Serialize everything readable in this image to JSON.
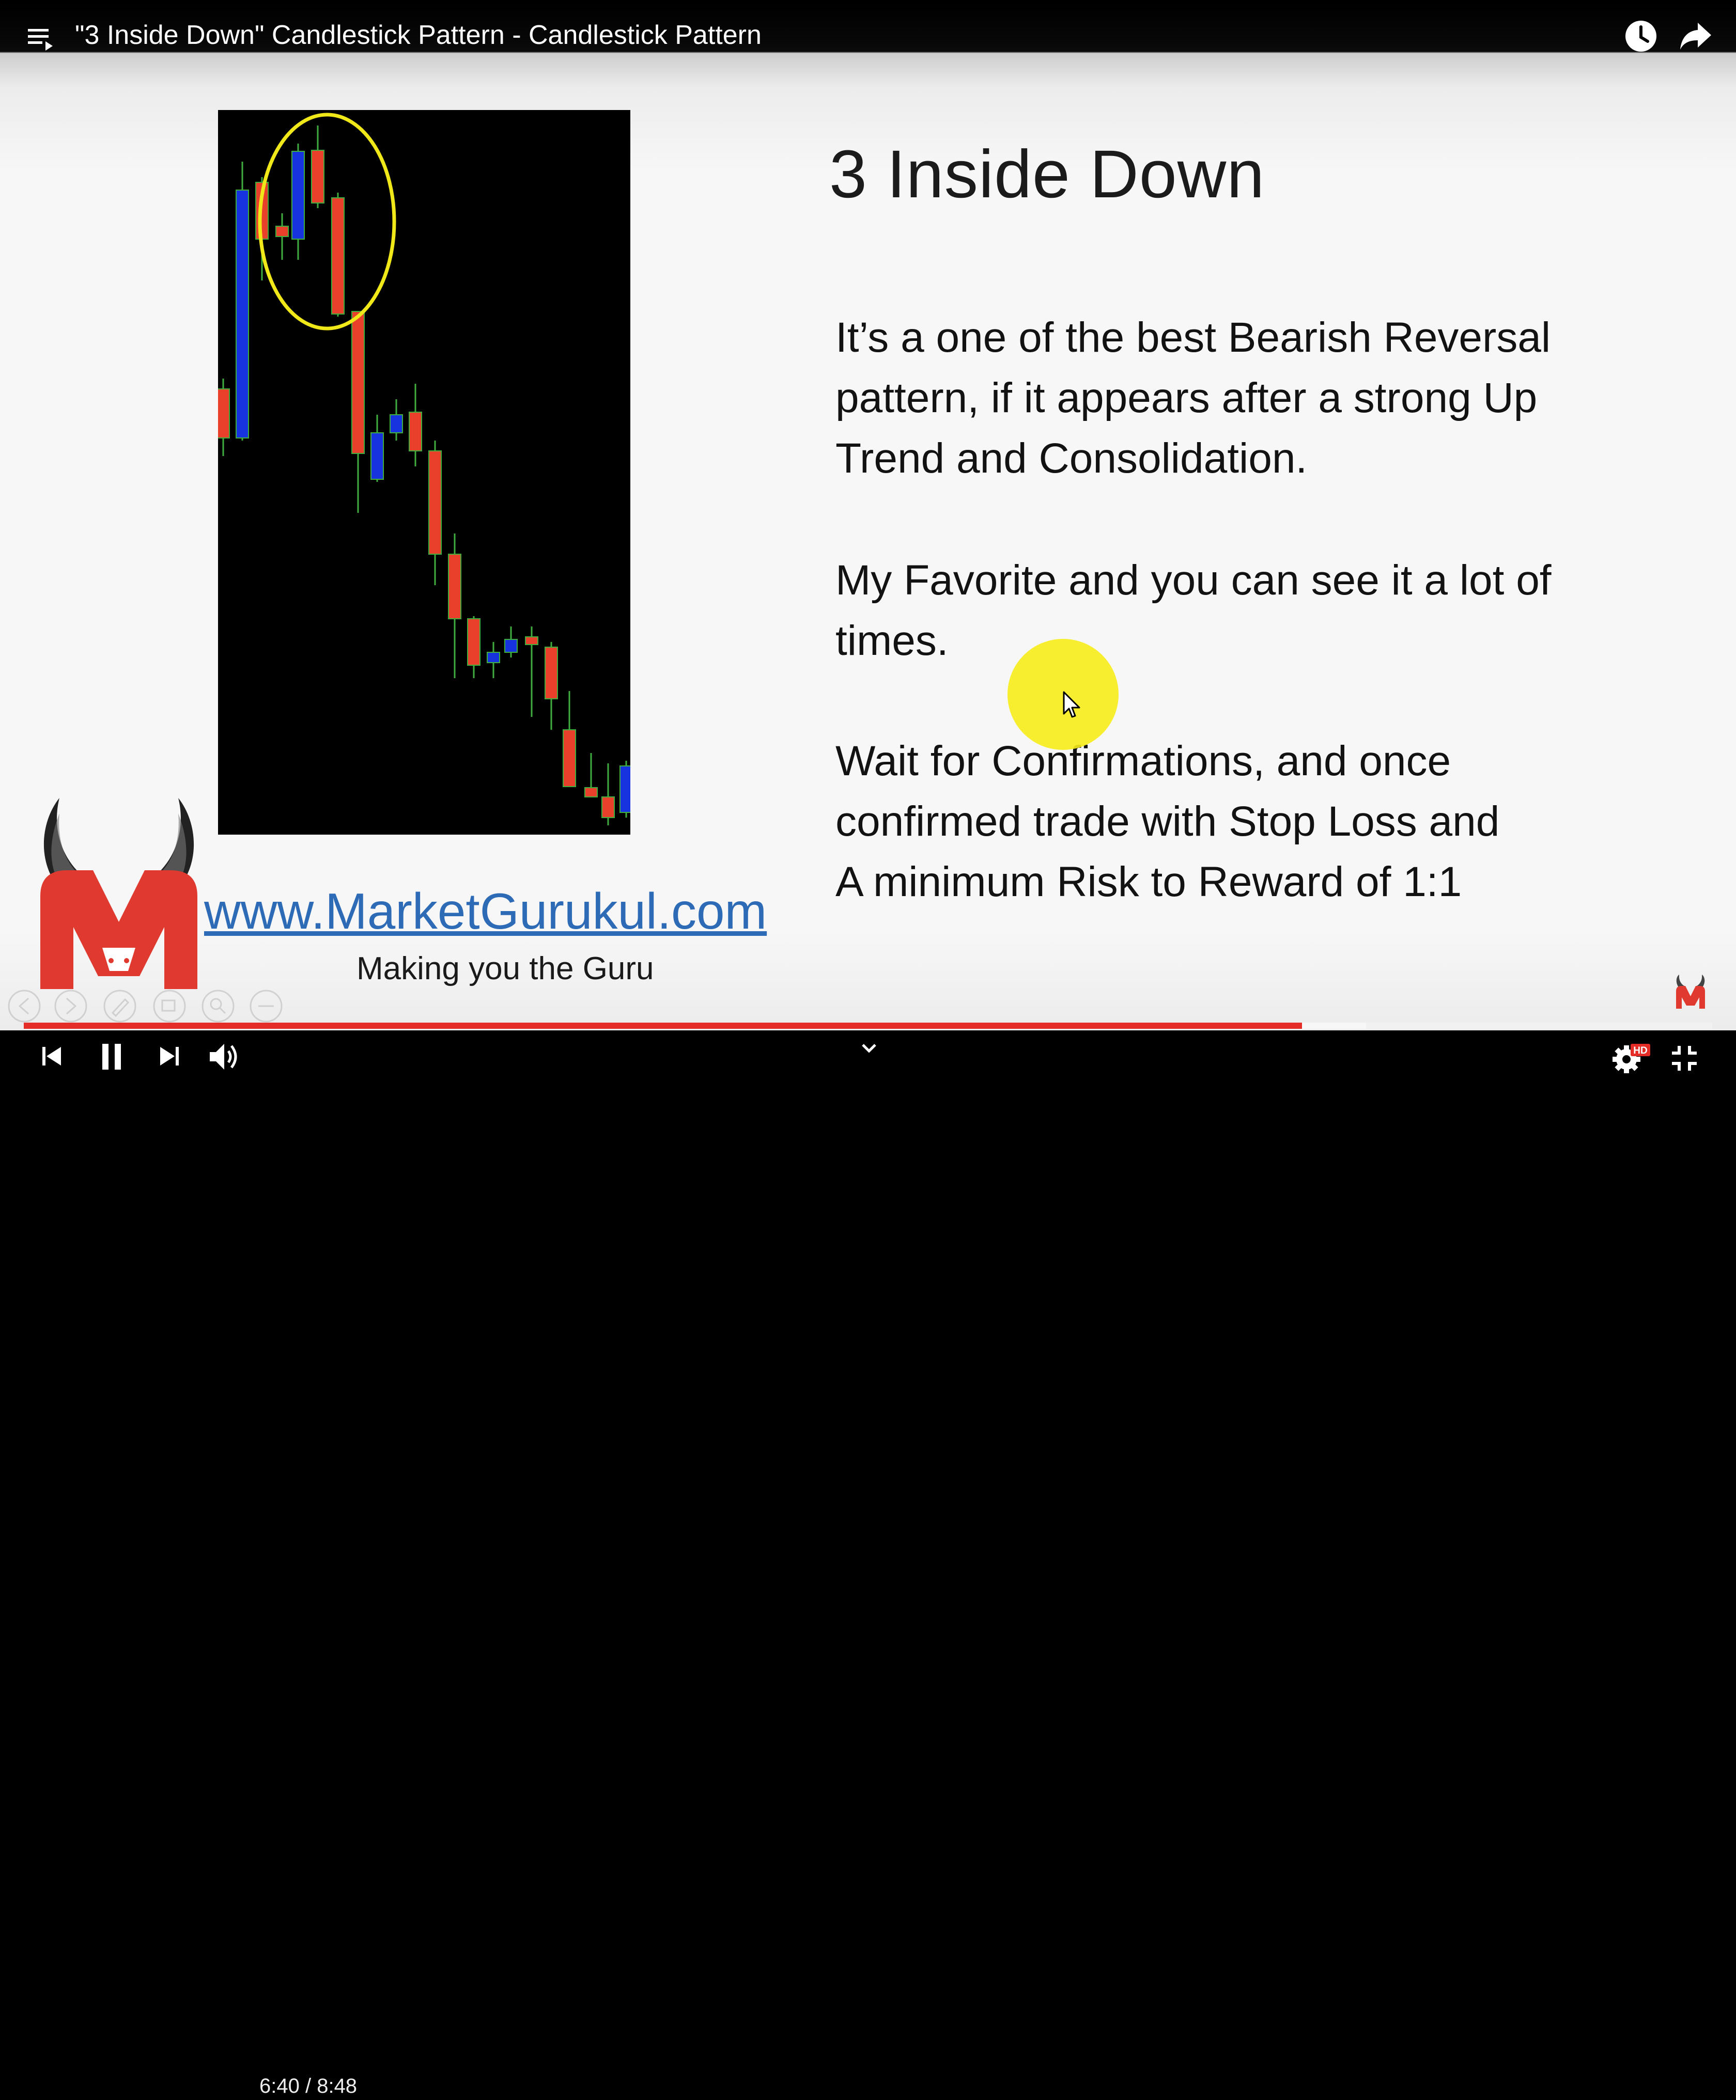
{
  "window": {
    "title": "\"3 Inside Down\" Candlestick Pattern - Candlestick Pattern"
  },
  "top_icons": [
    "playlist-icon",
    "watch-later-icon",
    "share-icon"
  ],
  "slide": {
    "title": "3 Inside Down",
    "paragraphs": [
      [
        "It’s a one of the best Bearish Reversal",
        "pattern, if it appears after a strong Up",
        "Trend and Consolidation."
      ],
      [
        "My Favorite and you can see it a lot of",
        "times."
      ],
      [
        "Wait for Confirmations, and once",
        "confirmed trade with Stop Loss and",
        "A minimum Risk to Reward of 1:1"
      ]
    ],
    "website": "www.MarketGurukul.com",
    "tagline": "Making you the Guru",
    "highlight_color": "#f0e818"
  },
  "player": {
    "current_time": "6:40",
    "duration": "8:48",
    "time_separator": " / ",
    "progress_played": 0.757,
    "progress_buffered": 0.795,
    "quality_badge": "HD",
    "accent_color": "#e52d27",
    "controls": [
      "previous-icon",
      "pause-icon",
      "next-icon",
      "volume-icon",
      "chevron-down-icon",
      "settings-icon",
      "exit-fullscreen-icon"
    ]
  }
}
